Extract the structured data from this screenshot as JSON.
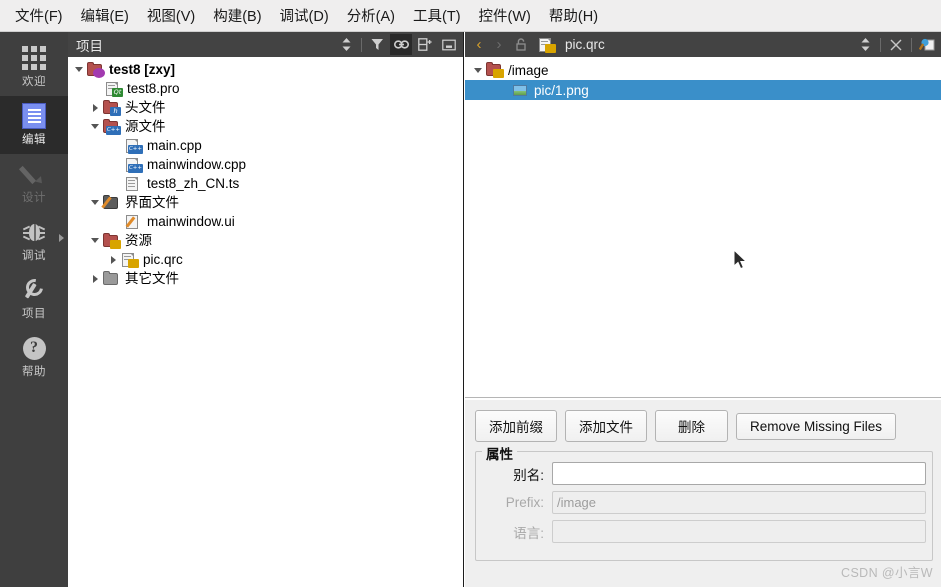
{
  "menubar": {
    "items": [
      {
        "label": "文件(F)",
        "name": "menu-file"
      },
      {
        "label": "编辑(E)",
        "name": "menu-edit"
      },
      {
        "label": "视图(V)",
        "name": "menu-view"
      },
      {
        "label": "构建(B)",
        "name": "menu-build"
      },
      {
        "label": "调试(D)",
        "name": "menu-debug"
      },
      {
        "label": "分析(A)",
        "name": "menu-analyze"
      },
      {
        "label": "工具(T)",
        "name": "menu-tools"
      },
      {
        "label": "控件(W)",
        "name": "menu-window"
      },
      {
        "label": "帮助(H)",
        "name": "menu-help"
      }
    ]
  },
  "modebar": {
    "items": [
      {
        "label": "欢迎",
        "icon": "grid-icon",
        "state": "normal"
      },
      {
        "label": "编辑",
        "icon": "document-icon",
        "state": "active"
      },
      {
        "label": "设计",
        "icon": "pencil-icon",
        "state": "disabled"
      },
      {
        "label": "调试",
        "icon": "bug-icon",
        "state": "normal"
      },
      {
        "label": "项目",
        "icon": "wrench-icon",
        "state": "normal"
      },
      {
        "label": "帮助",
        "icon": "question-mark-icon",
        "state": "normal"
      }
    ]
  },
  "project_panel": {
    "title": "项目",
    "toolbar": [
      {
        "name": "sync-selection-icon",
        "glyph": "⇕",
        "active": false
      },
      {
        "name": "filter-icon",
        "glyph": "▼",
        "active": false
      },
      {
        "name": "link-with-editor-icon",
        "glyph": "⛓",
        "active": true
      },
      {
        "name": "split-icon",
        "glyph": "⊟",
        "active": false
      },
      {
        "name": "collapse-icon",
        "glyph": "⊡",
        "active": false
      }
    ],
    "tree": [
      {
        "label": "test8 [zxy]",
        "indent": 0,
        "twist": "down",
        "icon": "project-folder-icon",
        "bold": true
      },
      {
        "label": "test8.pro",
        "indent": 1,
        "twist": "none",
        "icon": "qt-pro-file-icon",
        "bold": false
      },
      {
        "label": "头文件",
        "indent": 1,
        "twist": "right",
        "icon": "headers-folder-icon",
        "bold": false
      },
      {
        "label": "源文件",
        "indent": 1,
        "twist": "down",
        "icon": "sources-folder-icon",
        "bold": false
      },
      {
        "label": "main.cpp",
        "indent": 2,
        "twist": "none",
        "icon": "cpp-file-icon",
        "bold": false
      },
      {
        "label": "mainwindow.cpp",
        "indent": 2,
        "twist": "none",
        "icon": "cpp-file-icon",
        "bold": false
      },
      {
        "label": "test8_zh_CN.ts",
        "indent": 2,
        "twist": "none",
        "icon": "ts-file-icon",
        "bold": false
      },
      {
        "label": "界面文件",
        "indent": 1,
        "twist": "down",
        "icon": "forms-folder-icon",
        "bold": false
      },
      {
        "label": "mainwindow.ui",
        "indent": 2,
        "twist": "none",
        "icon": "ui-file-icon",
        "bold": false
      },
      {
        "label": "资源",
        "indent": 1,
        "twist": "down",
        "icon": "resource-folder-icon",
        "bold": false
      },
      {
        "label": "pic.qrc",
        "indent": 2,
        "twist": "right",
        "icon": "qrc-file-icon",
        "bold": false
      },
      {
        "label": "其它文件",
        "indent": 1,
        "twist": "right",
        "icon": "other-folder-icon",
        "bold": false
      }
    ]
  },
  "editor": {
    "header": {
      "back_glyph": "‹",
      "forward_glyph": "›",
      "lock_name": "lock-icon",
      "filename": "pic.qrc",
      "right_buttons": [
        {
          "name": "split-editor-icon",
          "glyph": "⇕"
        },
        {
          "name": "close-editor-icon",
          "glyph": "✕"
        },
        {
          "name": "editor-tools-icon",
          "glyph": "◧"
        }
      ]
    },
    "resource_tree": [
      {
        "label": "/image",
        "indent": 0,
        "twist": "down",
        "icon": "prefix-folder-icon",
        "selected": false
      },
      {
        "label": "pic/1.png",
        "indent": 1,
        "twist": "none",
        "icon": "image-file-icon",
        "selected": true
      }
    ]
  },
  "bottom": {
    "buttons": [
      {
        "label": "添加前缀",
        "name": "add-prefix-button"
      },
      {
        "label": "添加文件",
        "name": "add-file-button"
      },
      {
        "label": "删除",
        "name": "remove-button"
      },
      {
        "label": "Remove Missing Files",
        "name": "remove-missing-files-button"
      }
    ],
    "group_title": "属性",
    "fields": [
      {
        "label": "别名:",
        "value": "",
        "disabled": false,
        "name": "alias-field"
      },
      {
        "label": "Prefix:",
        "value": "/image",
        "disabled": true,
        "name": "prefix-field"
      },
      {
        "label": "语言:",
        "value": "",
        "disabled": true,
        "name": "language-field"
      }
    ]
  },
  "watermark": "CSDN @小言W",
  "colors": {
    "menubar_bg": "#efeeee",
    "modebar_bg": "#3f3f3f",
    "panel_header_bg": "#434343",
    "selection_blue": "#3a8fc9",
    "bottom_bg": "#efefef",
    "accent_yellow": "#d9a22a"
  }
}
